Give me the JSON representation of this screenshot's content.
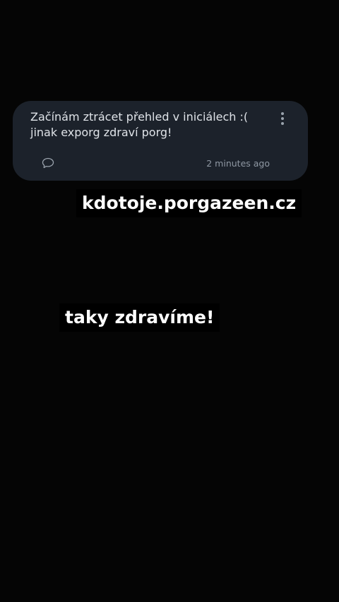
{
  "comment": {
    "text": "Začínám ztrácet přehled v iniciálech :( jinak exporg zdraví porg!",
    "timestamp": "2 minutes ago",
    "icons": {
      "more": "more-vertical-icon",
      "reply": "speech-bubble-icon"
    }
  },
  "captions": {
    "url": "kdotoje.porgazeen.cz",
    "greeting": "taky zdravíme!"
  },
  "colors": {
    "background": "#050505",
    "card": "#1c222b",
    "comment_text": "#dfe3e8",
    "muted_text": "#8f98a3",
    "caption_bg": "#000000",
    "caption_text": "#ffffff"
  }
}
